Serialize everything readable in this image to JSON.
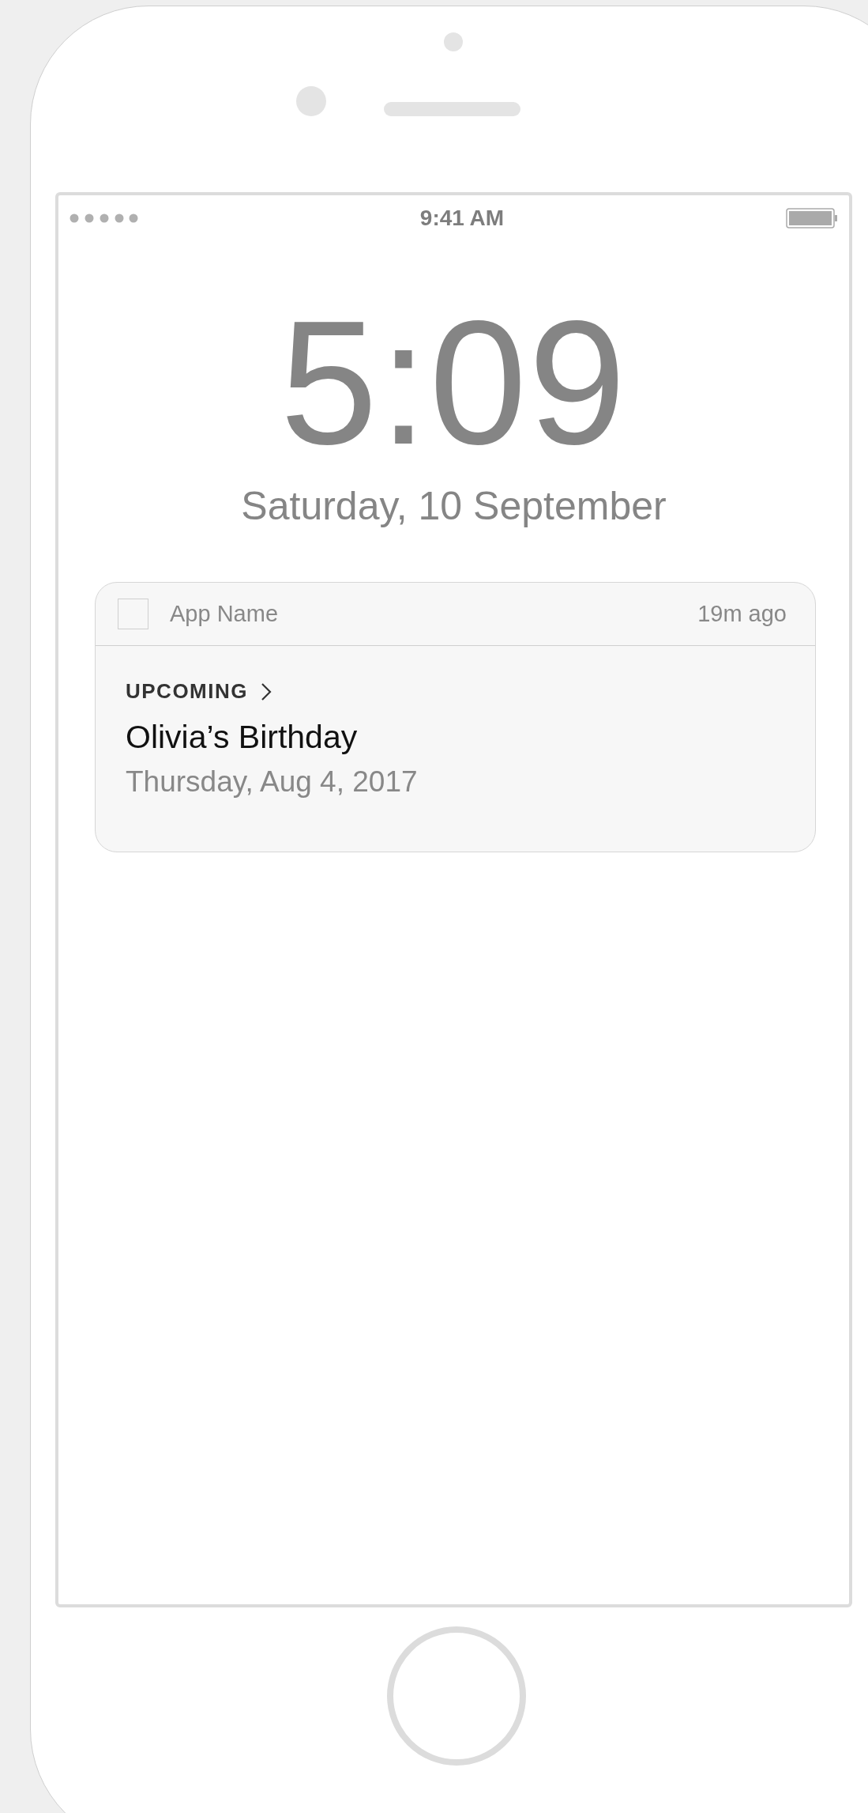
{
  "status_bar": {
    "time": "9:41 AM"
  },
  "lock_screen": {
    "time": "5:09",
    "date": "Saturday, 10 September"
  },
  "notification": {
    "app_name": "App Name",
    "age": "19m ago",
    "category": "UPCOMING",
    "title": "Olivia’s Birthday",
    "subtitle": "Thursday, Aug 4, 2017"
  }
}
